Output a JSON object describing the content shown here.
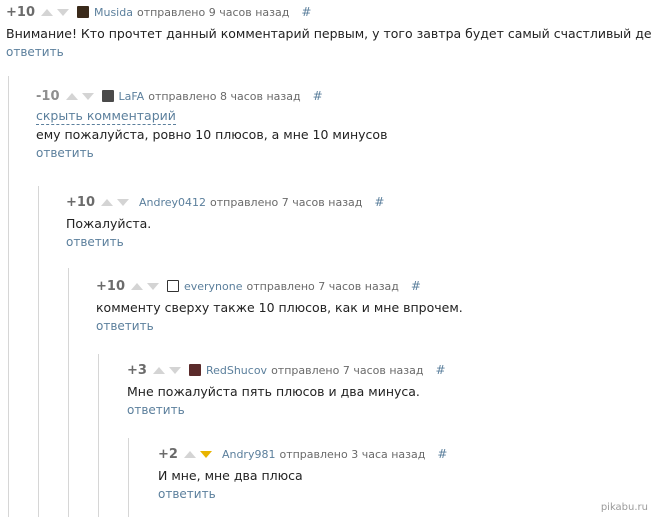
{
  "comments": [
    {
      "rating": "+10",
      "user": "Musida",
      "avatar_color": "#3a2a1a",
      "meta": "отправлено 9 часов назад",
      "hash": "#",
      "text": "Внимание! Кто прочтет данный комментарий первым, у того завтра будет самый счастливый день.",
      "reply": "ответить"
    },
    {
      "rating": "-10",
      "user": "LaFA",
      "avatar_color": "#4a4a4a",
      "meta": "отправлено 8 часов назад",
      "hash": "#",
      "hide": "скрыть комментарий",
      "text": "ему пожалуйста, ровно 10 плюсов, а мне 10 минусов",
      "reply": "ответить"
    },
    {
      "rating": "+10",
      "user": "Andrey0412",
      "meta": "отправлено 7 часов назад",
      "hash": "#",
      "text": "Пожалуйста.",
      "reply": "ответить"
    },
    {
      "rating": "+10",
      "user": "everynone",
      "avatar_color": "#333333",
      "meta": "отправлено 7 часов назад",
      "hash": "#",
      "text": "комменту сверху также 10 плюсов, как и мне впрочем.",
      "reply": "ответить"
    },
    {
      "rating": "+3",
      "user": "RedShucov",
      "avatar_color": "#5a2a2a",
      "meta": "отправлено 7 часов назад",
      "hash": "#",
      "text": "Мне пожалуйста пять плюсов и два минуса.",
      "reply": "ответить"
    },
    {
      "rating": "+2",
      "user": "Andry981",
      "downvote_color": "#e8b400",
      "meta": "отправлено 3 часа назад",
      "hash": "#",
      "text": "И мне, мне два плюса",
      "reply": "ответить"
    }
  ],
  "watermark": "pikabu.ru"
}
